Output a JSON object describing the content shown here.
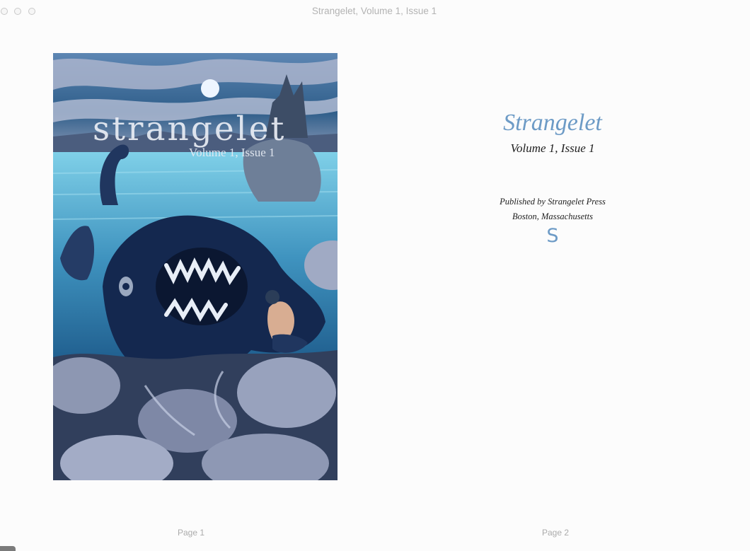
{
  "window": {
    "title": "Strangelet, Volume 1, Issue 1",
    "controls": [
      "close-icon",
      "minimize-icon",
      "zoom-icon"
    ]
  },
  "cover": {
    "title": "strangelet",
    "subtitle": "Volume 1, Issue 1"
  },
  "title_page": {
    "title": "Strangelet",
    "volume": "Volume 1, Issue 1",
    "publisher": "Published by Strangelet Press",
    "location": "Boston, Massachusetts",
    "logo": "S"
  },
  "pages": {
    "left_label": "Page 1",
    "right_label": "Page 2"
  },
  "colors": {
    "accent": "#6d9bc6",
    "sky": "#2f5e8a",
    "water": "#4fa9cf",
    "creature": "#14284f",
    "rock": "#8d97b2"
  }
}
